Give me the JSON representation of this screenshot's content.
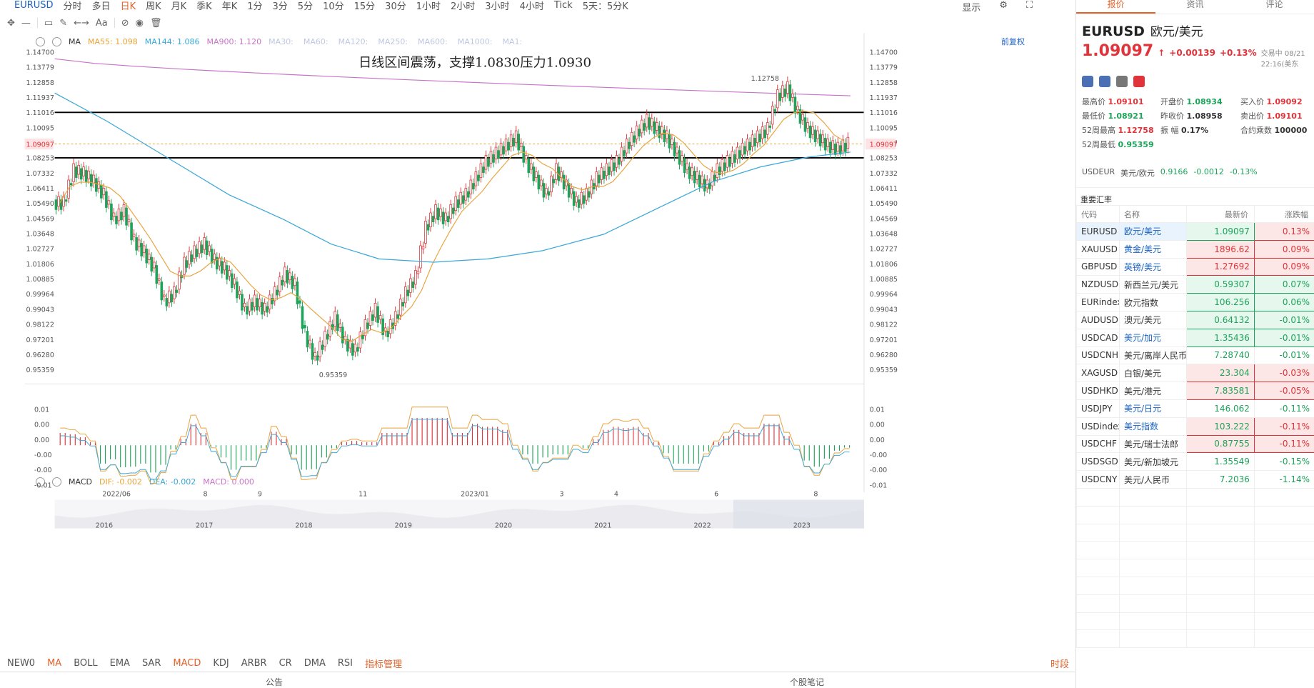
{
  "toolbar": {
    "symbol": "EURUSD",
    "periods": [
      "分时",
      "多日",
      "日K",
      "周K",
      "月K",
      "季K",
      "年K",
      "1分",
      "3分",
      "5分",
      "10分",
      "15分",
      "30分",
      "1小时",
      "2小时",
      "3小时",
      "4小时",
      "Tick",
      "5天：5分K"
    ],
    "active": "日K",
    "display": "显示"
  },
  "ma": {
    "label": "MA",
    "ma55": "MA55: 1.098",
    "ma144": "MA144: 1.086",
    "ma900": "MA900: 1.120",
    "others": [
      "MA30:",
      "MA60:",
      "MA120:",
      "MA250:",
      "MA600:",
      "MA1000:",
      "MA1:"
    ],
    "adj": "前复权"
  },
  "macd": {
    "label": "MACD",
    "dif": "DIF: -0.002",
    "dea": "DEA: -0.002",
    "macd": "MACD: 0.000"
  },
  "annotation": "日线区间震荡，支撑1.0830压力1.0930",
  "chart_data": {
    "type": "candlestick",
    "ylim": [
      0.9536,
      1.147
    ],
    "price_ticks": [
      "1.14700",
      "1.13779",
      "1.12858",
      "1.11937",
      "1.11016",
      "1.10095",
      "1.09097",
      "1.08253",
      "1.07332",
      "1.06411",
      "1.05490",
      "1.04569",
      "1.03648",
      "1.02727",
      "1.01806",
      "1.00885",
      "0.99964",
      "0.99043",
      "0.98122",
      "0.97201",
      "0.96280",
      "0.95359"
    ],
    "current_price": "1.09097",
    "resistance": 1.1102,
    "support": 1.0825,
    "high_label": "1.12758",
    "low_label": "0.95359",
    "x_labels": [
      "2022/06",
      "8",
      "9",
      "11",
      "2023/01",
      "3",
      "4",
      "6",
      "8"
    ],
    "ma_values": {
      "MA55": 1.098,
      "MA144": 1.086,
      "MA900": 1.12
    },
    "close_path": [
      1.055,
      1.075,
      1.073,
      1.068,
      1.06,
      1.045,
      1.05,
      1.032,
      1.025,
      1.015,
      0.995,
      1.0,
      1.018,
      1.025,
      1.03,
      1.02,
      1.015,
      1.005,
      0.99,
      0.995,
      0.99,
      1.0,
      1.012,
      1.005,
      0.975,
      0.96,
      0.973,
      0.985,
      0.97,
      0.965,
      0.98,
      0.99,
      0.975,
      0.985,
      1.0,
      1.01,
      1.04,
      1.05,
      1.045,
      1.055,
      1.06,
      1.07,
      1.08,
      1.085,
      1.09,
      1.095,
      1.08,
      1.07,
      1.06,
      1.075,
      1.065,
      1.055,
      1.06,
      1.07,
      1.075,
      1.08,
      1.09,
      1.098,
      1.105,
      1.1,
      1.095,
      1.085,
      1.075,
      1.07,
      1.065,
      1.075,
      1.08,
      1.085,
      1.09,
      1.095,
      1.1,
      1.12,
      1.125,
      1.11,
      1.1,
      1.095,
      1.09,
      1.088,
      1.091
    ],
    "macd_ticks": [
      "0.01",
      "0.00",
      "0.00",
      "-0.00",
      "-0.00",
      "-0.01"
    ],
    "overview_years": [
      "2016",
      "2017",
      "2018",
      "2019",
      "2020",
      "2021",
      "2022",
      "2023"
    ]
  },
  "indicators": [
    "NEW0",
    "MA",
    "BOLL",
    "EMA",
    "SAR",
    "MACD",
    "KDJ",
    "ARBR",
    "CR",
    "DMA",
    "RSI",
    "指标管理"
  ],
  "indicators_active": [
    "MA",
    "MACD",
    "指标管理"
  ],
  "indicators_right": "时段",
  "bottom": {
    "left": "公告",
    "right": "个股笔记"
  },
  "side": {
    "tabs": [
      "报价",
      "资讯",
      "评论"
    ],
    "title": "EURUSD",
    "title_cn": "欧元/美元",
    "price": "1.09097",
    "change": "+0.00139",
    "pct": "+0.13%",
    "time": "交易中 08/21 22:16(美东",
    "stats": [
      [
        "最高价",
        "1.09101",
        "开盘价",
        "1.08934",
        "买入价",
        "1.09092"
      ],
      [
        "最低价",
        "1.08921",
        "昨收价",
        "1.08958",
        "卖出价",
        "1.09101"
      ],
      [
        "52周最高",
        "1.12758",
        "振 幅",
        "0.17%",
        "合约乘数",
        "100000"
      ],
      [
        "52周最低",
        "0.95359",
        "",
        "",
        "",
        ""
      ]
    ],
    "usdeur": {
      "code": "USDEUR",
      "name": "美元/欧元",
      "price": "0.9166",
      "chg": "-0.0012",
      "pct": "-0.13%"
    },
    "section": "重要汇率",
    "table_head": [
      "代码",
      "名称",
      "最新价",
      "涨跌幅"
    ],
    "rows": [
      [
        "EURUSD",
        "欧元/美元",
        "1.09097",
        "0.13%",
        "up"
      ],
      [
        "XAUUSD",
        "黄金/美元",
        "1896.62",
        "0.09%",
        "up"
      ],
      [
        "GBPUSD",
        "英镑/美元",
        "1.27692",
        "0.09%",
        "up"
      ],
      [
        "NZDUSD",
        "新西兰元/美元",
        "0.59307",
        "0.07%",
        "up"
      ],
      [
        "EURindex",
        "欧元指数",
        "106.256",
        "0.06%",
        "up"
      ],
      [
        "AUDUSD",
        "澳元/美元",
        "0.64132",
        "-0.01%",
        "dn"
      ],
      [
        "USDCAD",
        "美元/加元",
        "1.35436",
        "-0.01%",
        "dn"
      ],
      [
        "USDCNH",
        "美元/离岸人民币",
        "7.28740",
        "-0.01%",
        "dn"
      ],
      [
        "XAGUSD",
        "白银/美元",
        "23.304",
        "-0.03%",
        "dn"
      ],
      [
        "USDHKD",
        "美元/港元",
        "7.83581",
        "-0.05%",
        "dn"
      ],
      [
        "USDJPY",
        "美元/日元",
        "146.062",
        "-0.11%",
        "dn"
      ],
      [
        "USDindex",
        "美元指数",
        "103.222",
        "-0.11%",
        "dn"
      ],
      [
        "USDCHF",
        "美元/瑞士法郎",
        "0.87755",
        "-0.11%",
        "dn"
      ],
      [
        "USDSGD",
        "美元/新加坡元",
        "1.35549",
        "-0.15%",
        "dn"
      ],
      [
        "USDCNY",
        "美元/人民币",
        "7.2036",
        "-1.14%",
        "dn"
      ]
    ]
  },
  "colors": {
    "up": "#e0343a",
    "down": "#1ea35a",
    "ma55": "#e8a23a",
    "ma144": "#3aa8d8",
    "ma900": "#c774c8",
    "accent": "#e2622a"
  }
}
